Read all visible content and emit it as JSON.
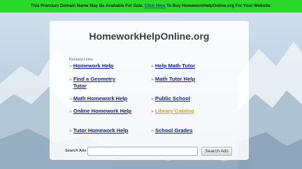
{
  "banner": {
    "text_before": "This Premium Domain Name May Be Available For Sale.",
    "link": "Click Here",
    "text_after": "To Buy HomeworkHelpOnline.org For Your Website."
  },
  "site": {
    "title": "HomeworkHelpOnline.org"
  },
  "related": {
    "heading": "Related Links",
    "left": [
      {
        "label": "Homework Help"
      },
      {
        "label": "Find a Geometry Tutor"
      },
      {
        "label": "Math Homework Help"
      },
      {
        "label": "Online Homework Help"
      },
      {
        "label": "Tutor Homework Help"
      }
    ],
    "right": [
      {
        "label": "Help Math Tutor"
      },
      {
        "label": "Math Tutor Help"
      },
      {
        "label": "Public School"
      },
      {
        "label": "Library Catalog"
      },
      {
        "label": "School Grades"
      }
    ]
  },
  "search": {
    "label": "Search Ads",
    "value": "",
    "button": "Search Ads"
  },
  "colors": {
    "banner": "#2bd92b",
    "link": "#12229a",
    "visited_link": "#f09a18"
  },
  "icons": {
    "link_bullet": "double-chevron-right-icon"
  }
}
